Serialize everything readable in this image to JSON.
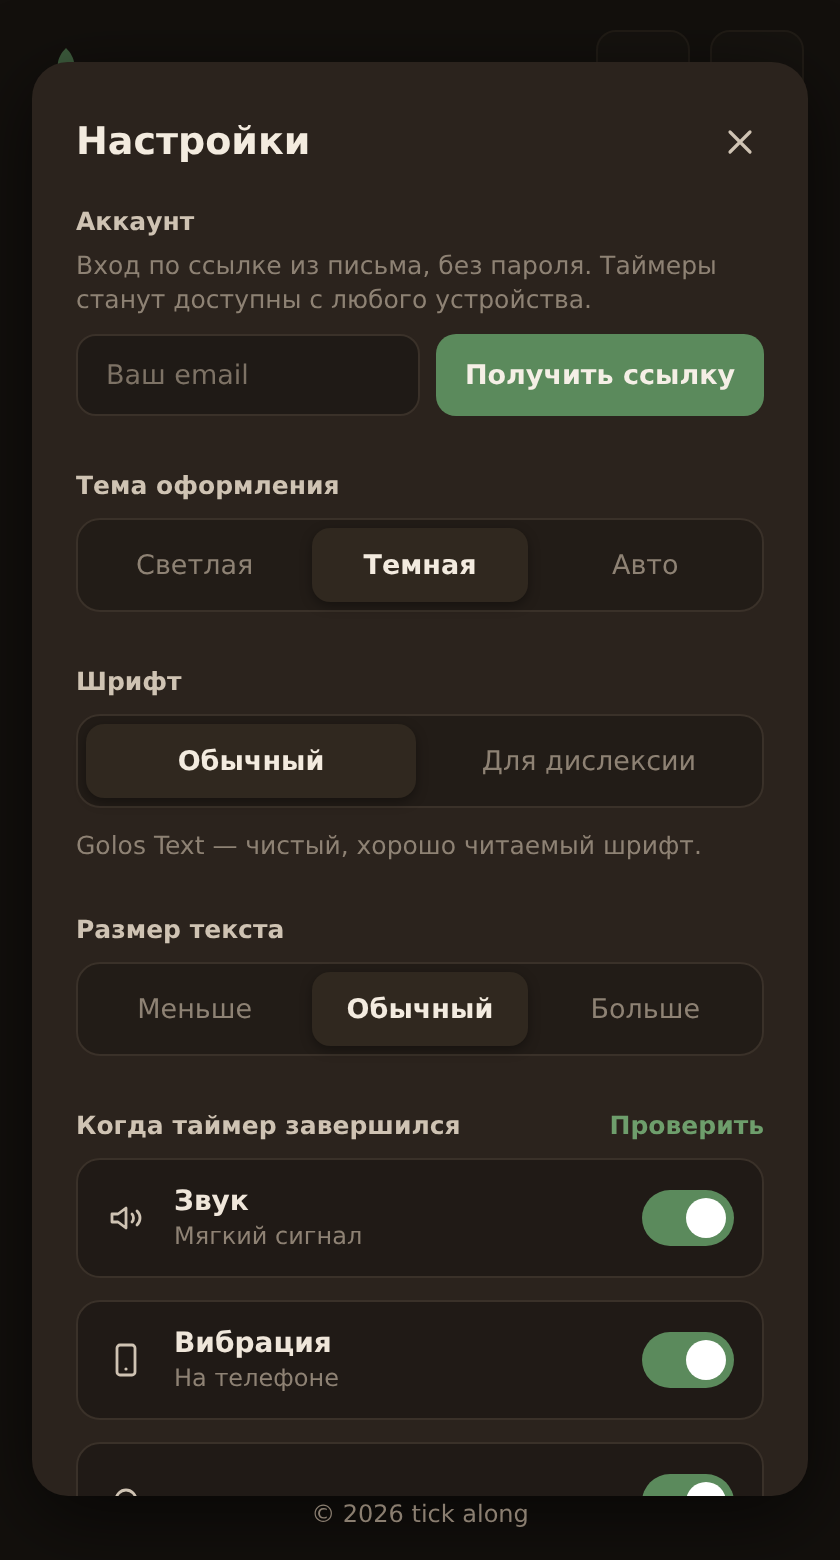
{
  "footer": {
    "text": "© 2026 tick along"
  },
  "dialog": {
    "title": "Настройки",
    "account": {
      "label": "Аккаунт",
      "description": "Вход по ссылке из письма, без пароля. Таймеры станут доступны с любого устройства.",
      "email": {
        "placeholder": "Ваш email"
      },
      "button": "Получить ссылку"
    },
    "theme": {
      "label": "Тема оформления",
      "options": [
        {
          "label": "Светлая",
          "selected": false
        },
        {
          "label": "Темная",
          "selected": true
        },
        {
          "label": "Авто",
          "selected": false
        }
      ]
    },
    "font": {
      "label": "Шрифт",
      "options": [
        {
          "label": "Обычный",
          "selected": true
        },
        {
          "label": "Для дислексии",
          "selected": false
        }
      ],
      "hint": "Golos Text — чистый, хорошо читаемый шрифт."
    },
    "text_size": {
      "label": "Размер текста",
      "options": [
        {
          "label": "Меньше",
          "selected": false
        },
        {
          "label": "Обычный",
          "selected": true
        },
        {
          "label": "Больше",
          "selected": false
        }
      ]
    },
    "notifications": {
      "label": "Когда таймер завершился",
      "action": "Проверить",
      "items": [
        {
          "title": "Звук",
          "subtitle": "Мягкий сигнал",
          "on": true
        },
        {
          "title": "Вибрация",
          "subtitle": "На телефоне",
          "on": true
        },
        {
          "on": true
        }
      ]
    }
  }
}
